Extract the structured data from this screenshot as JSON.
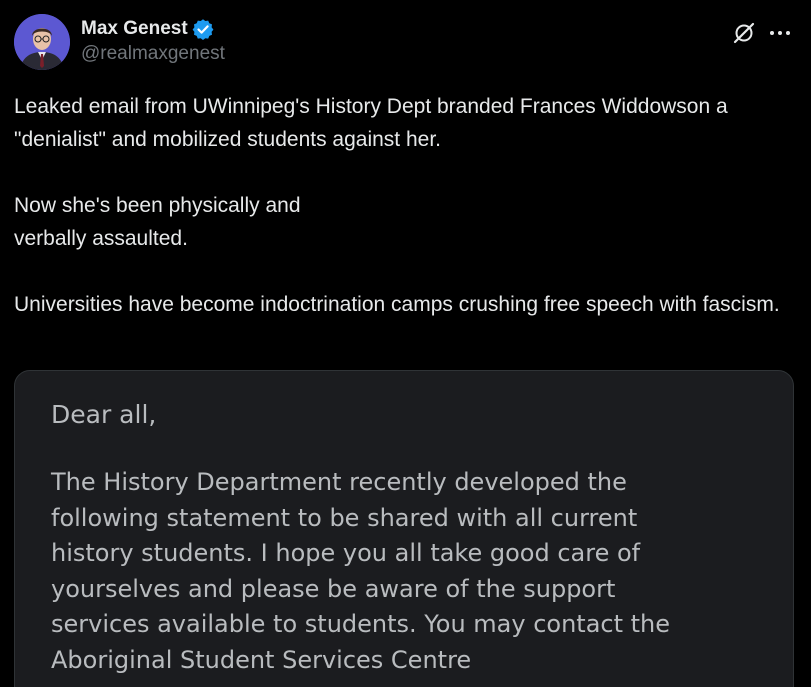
{
  "author": {
    "display_name": "Max Genest",
    "handle": "@realmaxgenest",
    "verified": true
  },
  "icons": {
    "verified": "verified-badge-icon",
    "grok": "grok-icon",
    "more": "more-options-icon"
  },
  "colors": {
    "background": "#000000",
    "text": "#e7e9ea",
    "muted": "#71767b",
    "verified_blue": "#1d9bf0",
    "media_bg": "#1b1c1f"
  },
  "post": {
    "paragraphs": [
      "Leaked email from UWinnipeg's History Dept branded Frances Widdowson a \"denialist\" and mobilized students against her.",
      "Now she's been physically and\nverbally assaulted.",
      "Universities have become indoctrination camps crushing free speech with fascism."
    ]
  },
  "media": {
    "greeting": "Dear all,",
    "lines": [
      "The History Department recently developed the",
      "following statement to be shared with all current",
      "history students. I hope you all take good care of",
      "yourselves and please be aware of the support",
      "services available to students. You may contact the",
      "Aboriginal Student Services Centre"
    ]
  }
}
